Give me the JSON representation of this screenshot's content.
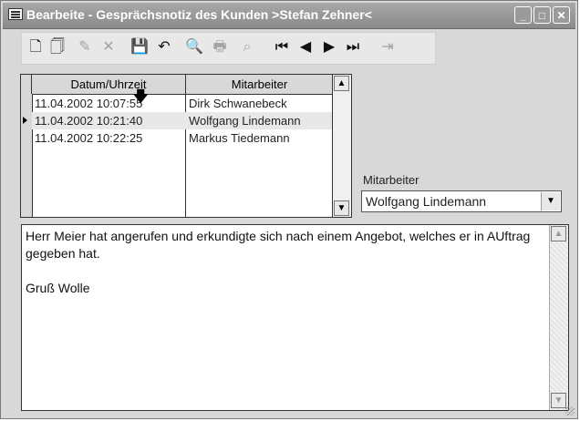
{
  "window": {
    "title": "Bearbeite - Gesprächsnotiz des Kunden >Stefan Zehner<",
    "controls": [
      "minimize",
      "maximize",
      "close"
    ]
  },
  "toolbar": {
    "buttons": [
      {
        "name": "new-icon",
        "glyph": "🗋",
        "enabled": true
      },
      {
        "name": "copy-icon",
        "glyph": "🗍",
        "enabled": true
      },
      {
        "name": "edit-icon",
        "glyph": "✎",
        "enabled": false
      },
      {
        "name": "delete-icon",
        "glyph": "✕",
        "enabled": false
      },
      {
        "name": "save-icon",
        "glyph": "💾",
        "enabled": true
      },
      {
        "name": "undo-icon",
        "glyph": "↶",
        "enabled": true
      },
      {
        "name": "preview-icon",
        "glyph": "🔍",
        "enabled": false
      },
      {
        "name": "print-icon",
        "glyph": "🖶",
        "enabled": false
      },
      {
        "name": "search-icon",
        "glyph": "⌕",
        "enabled": false
      },
      {
        "name": "first-record-icon",
        "glyph": "⏮",
        "enabled": true
      },
      {
        "name": "prev-record-icon",
        "glyph": "◀",
        "enabled": true
      },
      {
        "name": "next-record-icon",
        "glyph": "▶",
        "enabled": true
      },
      {
        "name": "last-record-icon",
        "glyph": "⏭",
        "enabled": true
      },
      {
        "name": "exit-icon",
        "glyph": "⇥",
        "enabled": false
      }
    ]
  },
  "grid": {
    "columns": [
      "Datum/Uhrzeit",
      "Mitarbeiter"
    ],
    "rows": [
      {
        "datetime": "11.04.2002 10:07:55",
        "employee": "Dirk Schwanebeck",
        "selected": false
      },
      {
        "datetime": "11.04.2002 10:21:40",
        "employee": "Wolfgang Lindemann",
        "selected": true
      },
      {
        "datetime": "11.04.2002 10:22:25",
        "employee": "Markus Tiedemann",
        "selected": false
      }
    ]
  },
  "employee_field": {
    "label": "Mitarbeiter",
    "value": "Wolfgang Lindemann"
  },
  "memo": {
    "text": "Herr Meier hat angerufen und erkundigte sich nach einem Angebot, welches er in AUftrag gegeben hat.\n\nGruß Wolle"
  }
}
